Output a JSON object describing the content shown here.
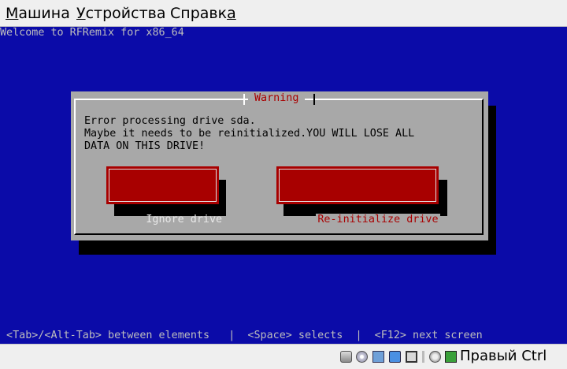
{
  "menubar": {
    "items": [
      {
        "first": "М",
        "rest": "ашина"
      },
      {
        "first": "У",
        "rest": "стройства"
      },
      {
        "first": "С",
        "rest": "правк",
        "last": "а"
      }
    ]
  },
  "console": {
    "welcome": "Welcome to RFRemix for x86_64",
    "status_line": " <Tab>/<Alt-Tab> between elements   |  <Space> selects  |  <F12> next screen"
  },
  "dialog": {
    "title": "Warning",
    "message": "Error processing drive sda.\nMaybe it needs to be reinitialized.YOU WILL LOSE ALL\nDATA ON THIS DRIVE!",
    "buttons": {
      "ignore": "Ignore drive",
      "reinit": "Re-initialize drive"
    },
    "focused_button": "reinit"
  },
  "statusbar": {
    "icons": [
      "hdd-icon",
      "cd-icon",
      "network-icon",
      "folder-icon",
      "display-icon",
      "video-icon",
      "mouse-icon",
      "arrow-icon"
    ],
    "host_key": "Правый Ctrl"
  }
}
